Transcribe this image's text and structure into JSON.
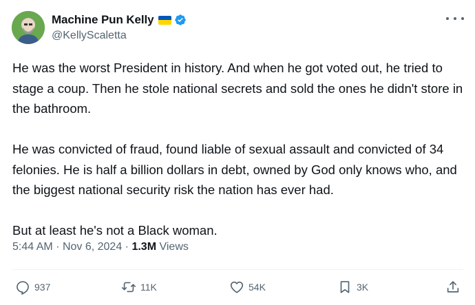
{
  "author": {
    "display_name": "Machine Pun Kelly",
    "handle": "@KellyScaletta",
    "flag_icon": "ukraine-flag-icon",
    "verified_icon": "verified-badge-icon",
    "colors": {
      "verified": "#1d9bf0",
      "flag_top": "#0057b7",
      "flag_bottom": "#ffd700"
    }
  },
  "post": {
    "paragraphs": [
      "He was the worst President in history. And when he got voted out, he tried to stage a coup. Then he stole national secrets and sold the ones he didn't store in the bathroom.",
      "He was convicted of fraud, found liable of sexual assault and convicted of 34 felonies. He is half a billion dollars in debt, owned by God only knows who, and the biggest national security risk the nation has ever had.",
      "But at least he's not a Black woman."
    ]
  },
  "meta": {
    "time": "5:44 AM",
    "separator": "·",
    "date": "Nov 6, 2024",
    "views_count": "1.3M",
    "views_label": "Views"
  },
  "actions": {
    "replies": "937",
    "reposts": "11K",
    "likes": "54K",
    "bookmarks": "3K"
  }
}
